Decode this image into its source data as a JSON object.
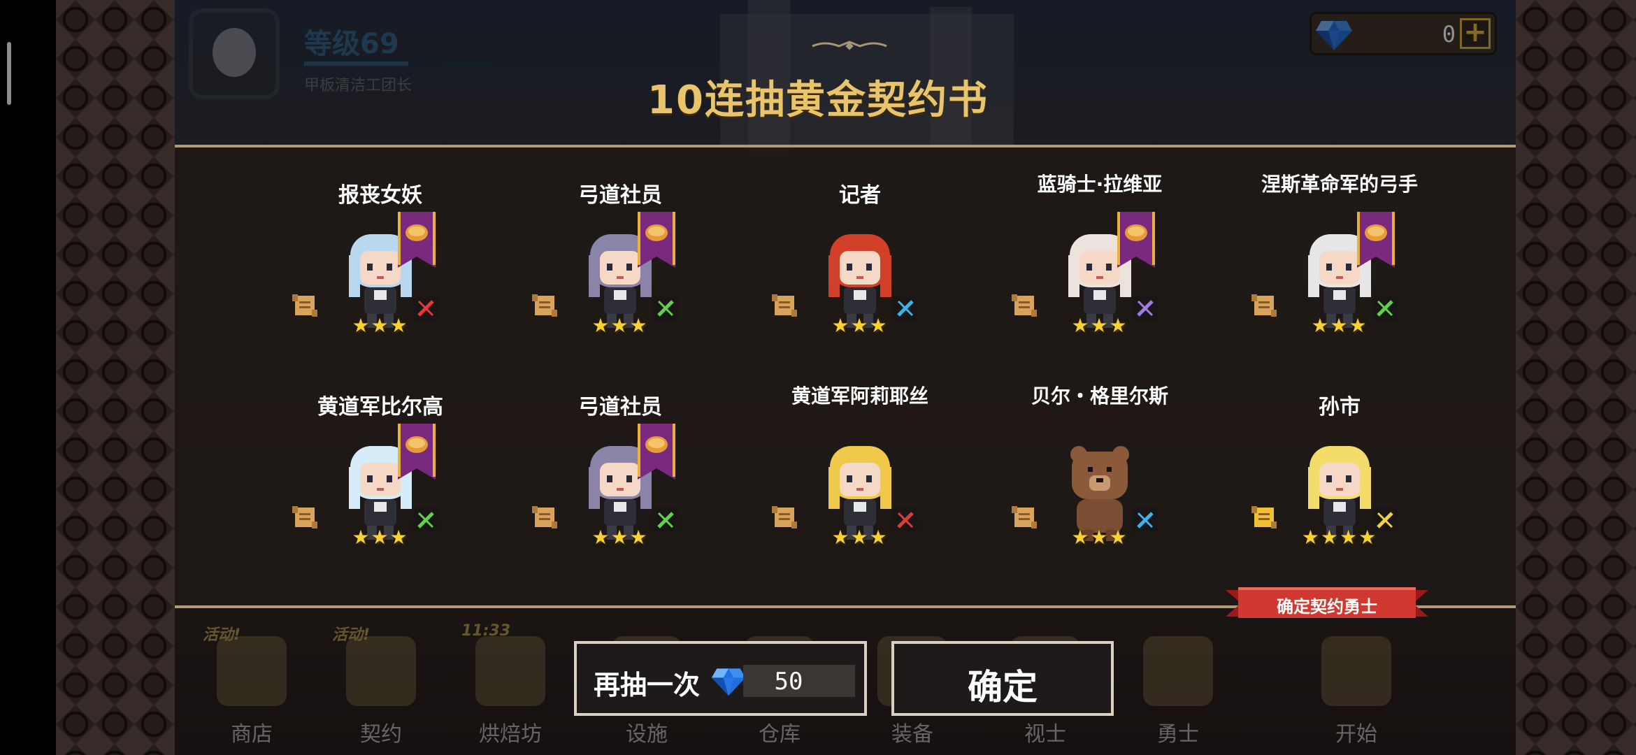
{
  "player": {
    "level": "等级69",
    "title": "甲板清洁工团长",
    "xp_fraction": 0.55
  },
  "currency": {
    "gems": "0",
    "add_symbol": "+"
  },
  "dialog": {
    "title": "10连抽黄金契约书"
  },
  "results": [
    {
      "name": "报丧女妖",
      "stars": "★★★",
      "banner": true,
      "class_icon": "sword-icon",
      "class_color": "#e03a3a"
    },
    {
      "name": "弓道社员",
      "stars": "★★★",
      "banner": true,
      "class_icon": "bow-icon",
      "class_color": "#5fd24a"
    },
    {
      "name": "记者",
      "stars": "★★★",
      "banner": false,
      "class_icon": "hammer-icon",
      "class_color": "#3fb2e6"
    },
    {
      "name": "蓝骑士·拉维亚",
      "stars": "★★★",
      "banner": true,
      "class_icon": "staff-icon",
      "class_color": "#a07ae6"
    },
    {
      "name": "涅斯革命军的弓手",
      "stars": "★★★",
      "banner": true,
      "class_icon": "bow-icon",
      "class_color": "#5fd24a"
    },
    {
      "name": "黄道军比尔高",
      "stars": "★★★",
      "banner": true,
      "class_icon": "bow-icon",
      "class_color": "#5fd24a"
    },
    {
      "name": "弓道社员",
      "stars": "★★★",
      "banner": true,
      "class_icon": "bow-icon",
      "class_color": "#5fd24a"
    },
    {
      "name": "黄道军阿莉耶丝",
      "stars": "★★★",
      "banner": false,
      "class_icon": "sword-icon",
      "class_color": "#e03a3a"
    },
    {
      "name": "贝尔・格里尔斯",
      "stars": "★★★",
      "banner": false,
      "class_icon": "hammer-icon",
      "class_color": "#3fb2e6"
    },
    {
      "name": "孙市",
      "stars": "★★★★",
      "banner": false,
      "class_icon": "gun-icon",
      "class_color": "#f2d23a"
    }
  ],
  "guaranteed_label": "确定契约勇士",
  "nav": {
    "items": [
      {
        "label": "商店",
        "badge": "活动!"
      },
      {
        "label": "契约",
        "badge": "活动!"
      },
      {
        "label": "烘焙坊",
        "badge": "11:33"
      },
      {
        "label": "设施",
        "badge": ""
      },
      {
        "label": "仓库",
        "badge": ""
      },
      {
        "label": "装备",
        "badge": ""
      },
      {
        "label": "视士",
        "badge": ""
      },
      {
        "label": "勇士",
        "badge": ""
      },
      {
        "label": "开始",
        "badge": ""
      }
    ]
  },
  "buttons": {
    "draw_again": "再抽一次",
    "draw_again_cost": "50",
    "confirm": "确定"
  }
}
